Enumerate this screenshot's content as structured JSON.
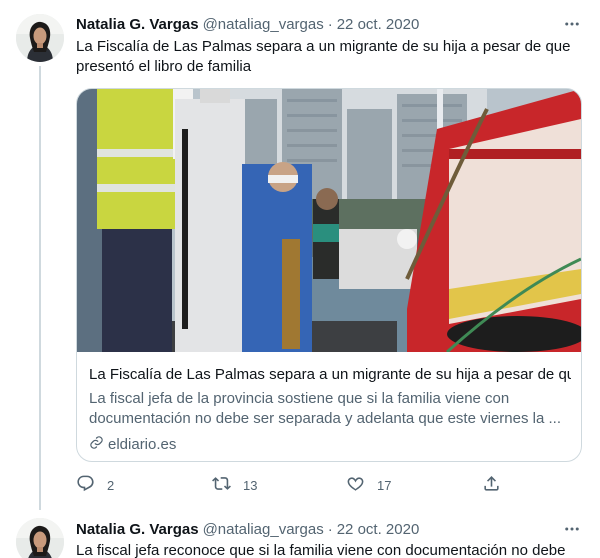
{
  "tweets": [
    {
      "author": {
        "name": "Natalia G. Vargas",
        "handle": "@nataliag_vargas"
      },
      "separator": "·",
      "date": "22 oct. 2020",
      "text": "La Fiscalía de Las Palmas separa a un migrante de su hija a pesar de que presentó el libro de familia",
      "card": {
        "title": "La Fiscalía de Las Palmas separa a un migrante de su hija a pesar de qu...",
        "description": "La fiscal jefa de la provincia sostiene que si la familia viene con documentación no debe ser separada y adelanta que este viernes la ...",
        "source": "eldiario.es"
      },
      "stats": {
        "replies": "2",
        "retweets": "13",
        "likes": "17"
      }
    },
    {
      "author": {
        "name": "Natalia G. Vargas",
        "handle": "@nataliag_vargas"
      },
      "separator": "·",
      "date": "22 oct. 2020",
      "text": "La fiscal jefa reconoce que si la familia viene con documentación no debe"
    }
  ],
  "icons": {
    "more": "more-icon",
    "reply": "reply-icon",
    "retweet": "retweet-icon",
    "like": "like-icon",
    "share": "share-icon",
    "link": "link-icon"
  },
  "colors": {
    "text_primary": "#0f1419",
    "text_secondary": "#536471",
    "border": "#cfd9de"
  }
}
